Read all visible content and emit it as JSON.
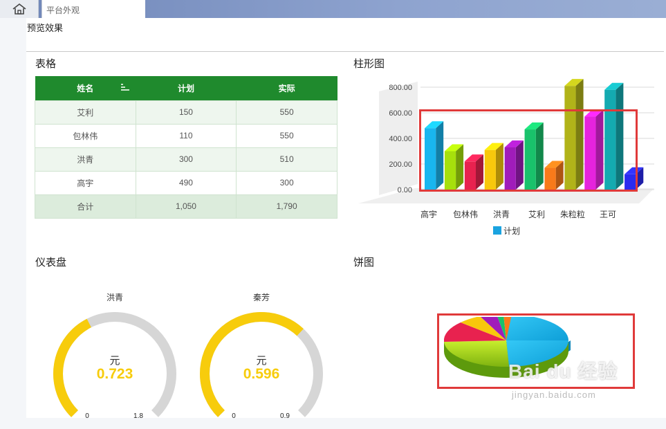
{
  "topbar": {
    "tab_label": "平台外观"
  },
  "page": {
    "preview_label": "预览效果"
  },
  "table_section": {
    "title": "表格",
    "headers": [
      "姓名",
      "计划",
      "实际"
    ],
    "rows": [
      [
        "艾利",
        "150",
        "550"
      ],
      [
        "包林伟",
        "110",
        "550"
      ],
      [
        "洪青",
        "300",
        "510"
      ],
      [
        "高宇",
        "490",
        "300"
      ]
    ],
    "total": [
      "合计",
      "1,050",
      "1,790"
    ]
  },
  "bar_section": {
    "title": "柱形图",
    "legend_label": "计划",
    "legend_color": "#1aa3e0"
  },
  "gauge_section": {
    "title": "仪表盘",
    "gauges": [
      {
        "name": "洪青",
        "unit": "元",
        "value": "0.723",
        "min": "0",
        "max": "1.8",
        "fraction": 0.4
      },
      {
        "name": "秦芳",
        "unit": "元",
        "value": "0.596",
        "min": "0",
        "max": "0.9",
        "fraction": 0.66
      }
    ],
    "track_color": "#d6d6d6",
    "fill_color": "#f7cc0c"
  },
  "pie_section": {
    "title": "饼图"
  },
  "watermark": {
    "main": "Bai du 经验",
    "sub": "jingyan.baidu.com"
  },
  "chart_data": {
    "type": "bar",
    "categories": [
      "高宇",
      "包林伟",
      "洪青",
      "艾利",
      "朱粒粒",
      "王可"
    ],
    "series": [
      {
        "name": "计划",
        "values": [
          480,
          300,
          220,
          310,
          330,
          470,
          170,
          810,
          570,
          780,
          120
        ]
      }
    ],
    "bar_colors": [
      "#19b6ef",
      "#a6e00c",
      "#e8224f",
      "#f8c80c",
      "#a01cba",
      "#19c26b",
      "#f87a1a",
      "#b1b319",
      "#e623dd",
      "#14aab0",
      "#2b2bf0"
    ],
    "ylim": [
      0,
      800
    ],
    "yticks": [
      "0.00",
      "200.00",
      "400.00",
      "600.00",
      "800.00"
    ],
    "grid": true,
    "legend_position": "bottom"
  }
}
